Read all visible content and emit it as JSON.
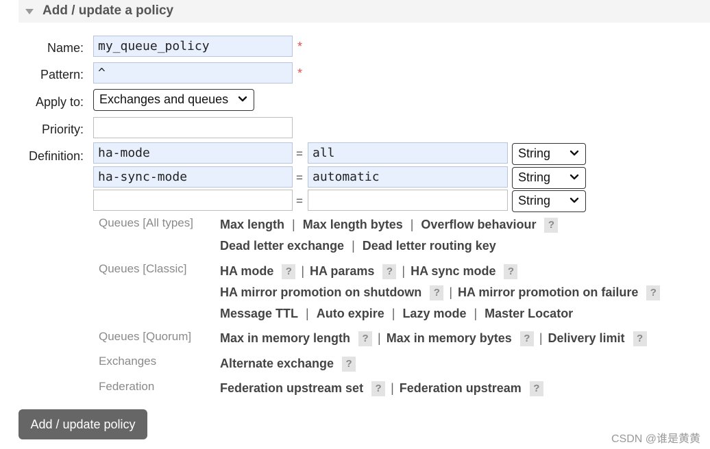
{
  "section": {
    "title": "Add / update a policy"
  },
  "form": {
    "name_label": "Name:",
    "name_value": "my_queue_policy",
    "pattern_label": "Pattern:",
    "pattern_value": "^",
    "required_mark": "*",
    "apply_to_label": "Apply to:",
    "apply_to_value": "Exchanges and queues",
    "priority_label": "Priority:",
    "priority_value": "",
    "definition_label": "Definition:",
    "equals": "=",
    "definition_rows": [
      {
        "key": "ha-mode",
        "value": "all",
        "type": "String"
      },
      {
        "key": "ha-sync-mode",
        "value": "automatic",
        "type": "String"
      },
      {
        "key": "",
        "value": "",
        "type": "String"
      }
    ]
  },
  "separator": "|",
  "help_mark": "?",
  "categories": {
    "queues_all": {
      "label": "Queues [All types]",
      "keys": [
        "Max length",
        "Max length bytes",
        "Overflow behaviour",
        "Dead letter exchange",
        "Dead letter routing key"
      ]
    },
    "queues_classic": {
      "label": "Queues [Classic]",
      "keys": [
        "HA mode",
        "HA params",
        "HA sync mode",
        "HA mirror promotion on shutdown",
        "HA mirror promotion on failure",
        "Message TTL",
        "Auto expire",
        "Lazy mode",
        "Master Locator"
      ]
    },
    "queues_quorum": {
      "label": "Queues [Quorum]",
      "keys": [
        "Max in memory length",
        "Max in memory bytes",
        "Delivery limit"
      ]
    },
    "exchanges": {
      "label": "Exchanges",
      "keys": [
        "Alternate exchange"
      ]
    },
    "federation": {
      "label": "Federation",
      "keys": [
        "Federation upstream set",
        "Federation upstream"
      ]
    }
  },
  "submit_label": "Add / update policy",
  "watermark": "CSDN @谁是黄黄"
}
